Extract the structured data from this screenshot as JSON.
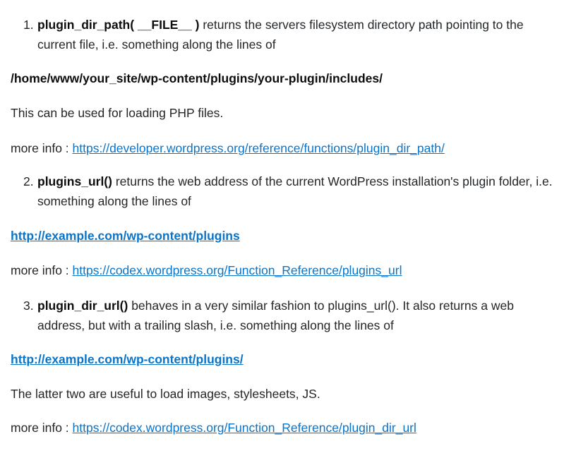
{
  "item1": {
    "number": "1.",
    "code": "plugin_dir_path( __FILE__ )",
    "text_line1": " returns the servers filesystem directory path pointing to the",
    "text_line2": "current file, i.e. something along the lines of"
  },
  "path_example": "/home/www/your_site/wp-content/plugins/your-plugin/includes/",
  "php_note": "This can be used for loading PHP files.",
  "more_info_1": {
    "label": "more info : ",
    "link": "https://developer.wordpress.org/reference/functions/plugin_dir_path/"
  },
  "item2": {
    "number": "2.",
    "code": "plugins_url()",
    "text_line1": " returns the web address of the current WordPress installation's plugin folder, i.e.",
    "text_line2": "something along the lines of"
  },
  "url_example_1": "http://example.com/wp-content/plugins",
  "more_info_2": {
    "label": "more info : ",
    "link": "https://codex.wordpress.org/Function_Reference/plugins_url"
  },
  "item3": {
    "number": "3.",
    "code": "plugin_dir_url()",
    "text_line1": " behaves in a very similar fashion to plugins_url(). It also returns a web",
    "text_line2": "address, but with a trailing slash, i.e. something along the lines of"
  },
  "url_example_2": "http://example.com/wp-content/plugins/",
  "latter_note": "The latter two are useful to load images, stylesheets, JS.",
  "more_info_3": {
    "label": "more info : ",
    "link": "https://codex.wordpress.org/Function_Reference/plugin_dir_url"
  }
}
